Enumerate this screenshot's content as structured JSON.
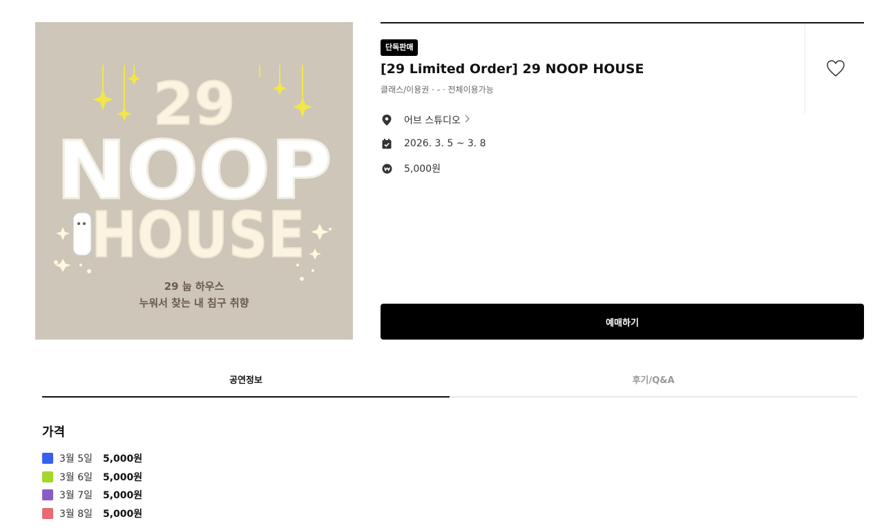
{
  "product": {
    "badge": "단독판매",
    "title": "[29 Limited Order] 29 NOOP HOUSE",
    "subtitle": "클래스/이용권 · - · 전체이용가능",
    "venue": "어브 스튜디오",
    "dates": "2026. 3. 5 ~ 3. 8",
    "price": "5,000원",
    "buy_label": "예매하기"
  },
  "poster": {
    "line1": "29",
    "line2": "NOOP",
    "line3": "HOUSE",
    "caption1": "29 눕 하우스",
    "caption2": "누워서 찾는 내 침구 취향"
  },
  "icons": {
    "heart": "heart-icon",
    "location": "location-pin-icon",
    "calendar": "calendar-check-icon",
    "price": "won-coin-icon",
    "chevron": "chevron-right-icon"
  },
  "tabs": [
    {
      "label": "공연정보",
      "active": true
    },
    {
      "label": "후기/Q&A",
      "active": false
    }
  ],
  "pricing": {
    "title": "가격",
    "rows": [
      {
        "date": "3월 5일",
        "price": "5,000원",
        "color": "#3660f0"
      },
      {
        "date": "3월 6일",
        "price": "5,000원",
        "color": "#a5d62c"
      },
      {
        "date": "3월 7일",
        "price": "5,000원",
        "color": "#8a5dc6"
      },
      {
        "date": "3월 8일",
        "price": "5,000원",
        "color": "#e96a72"
      }
    ]
  }
}
